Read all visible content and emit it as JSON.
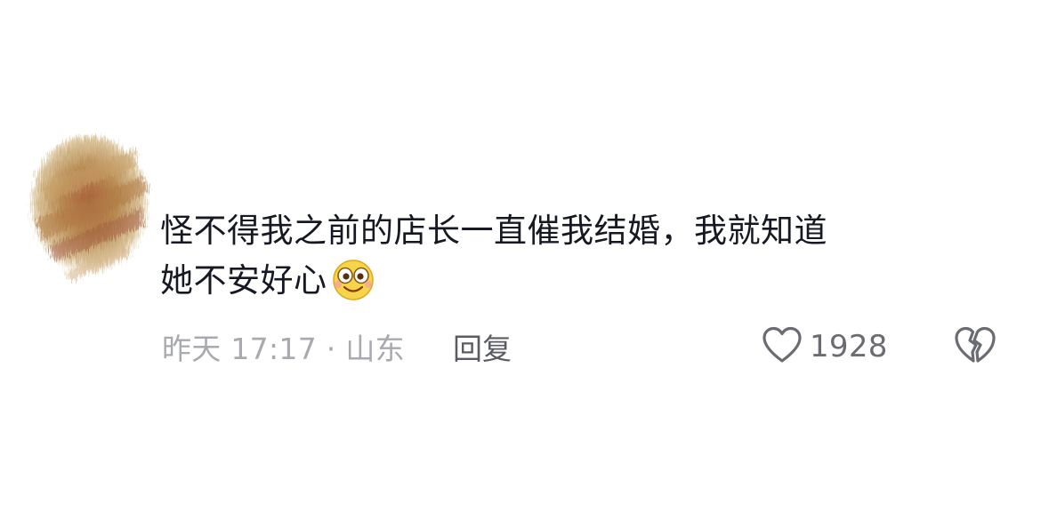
{
  "comment": {
    "text_line1": "怪不得我之前的店长一直催我结婚，我就知道",
    "text_line2": "她不安好心",
    "emoji": "smiling-face-emoji",
    "meta": {
      "time_location": "昨天 17:17 · 山东",
      "reply_label": "回复"
    },
    "likes": {
      "count": "1928",
      "icon": "heart-outline-icon"
    },
    "dislike_icon": "broken-heart-icon"
  },
  "colors": {
    "text_primary": "#161823",
    "text_meta": "#a9aaaf",
    "reply": "#5a5b63",
    "icon": "#6b6c73",
    "emoji_face": "#f7d54a"
  }
}
